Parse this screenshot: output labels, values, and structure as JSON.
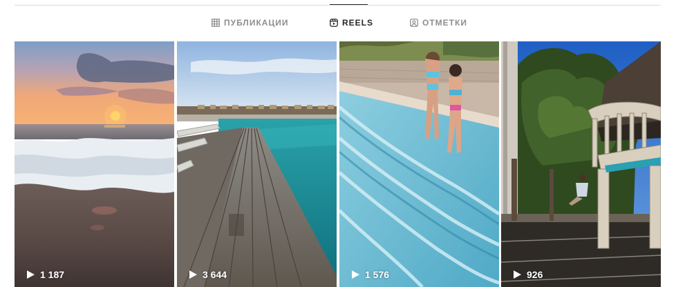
{
  "tabs": [
    {
      "label": "ПУБЛИКАЦИИ",
      "icon": "grid-icon",
      "active": false
    },
    {
      "label": "REELS",
      "icon": "reels-icon",
      "active": true
    },
    {
      "label": "ОТМЕТКИ",
      "icon": "tagged-user-icon",
      "active": false
    }
  ],
  "reels": [
    {
      "views": "1 187",
      "scene": "sunset-beach-waves",
      "icon": "play-icon"
    },
    {
      "views": "3 644",
      "scene": "wooden-deck-by-pool-with-umbrellas",
      "icon": "play-icon"
    },
    {
      "views": "1 576",
      "scene": "two-girls-in-swimsuits-on-pool-steps",
      "icon": "play-icon"
    },
    {
      "views": "926",
      "scene": "wooden-chair-on-terrace-with-trees",
      "icon": "play-icon"
    }
  ],
  "colors": {
    "active_tab": "#262626",
    "inactive_tab": "#8e8e8e",
    "divider": "#dbdbdb"
  }
}
